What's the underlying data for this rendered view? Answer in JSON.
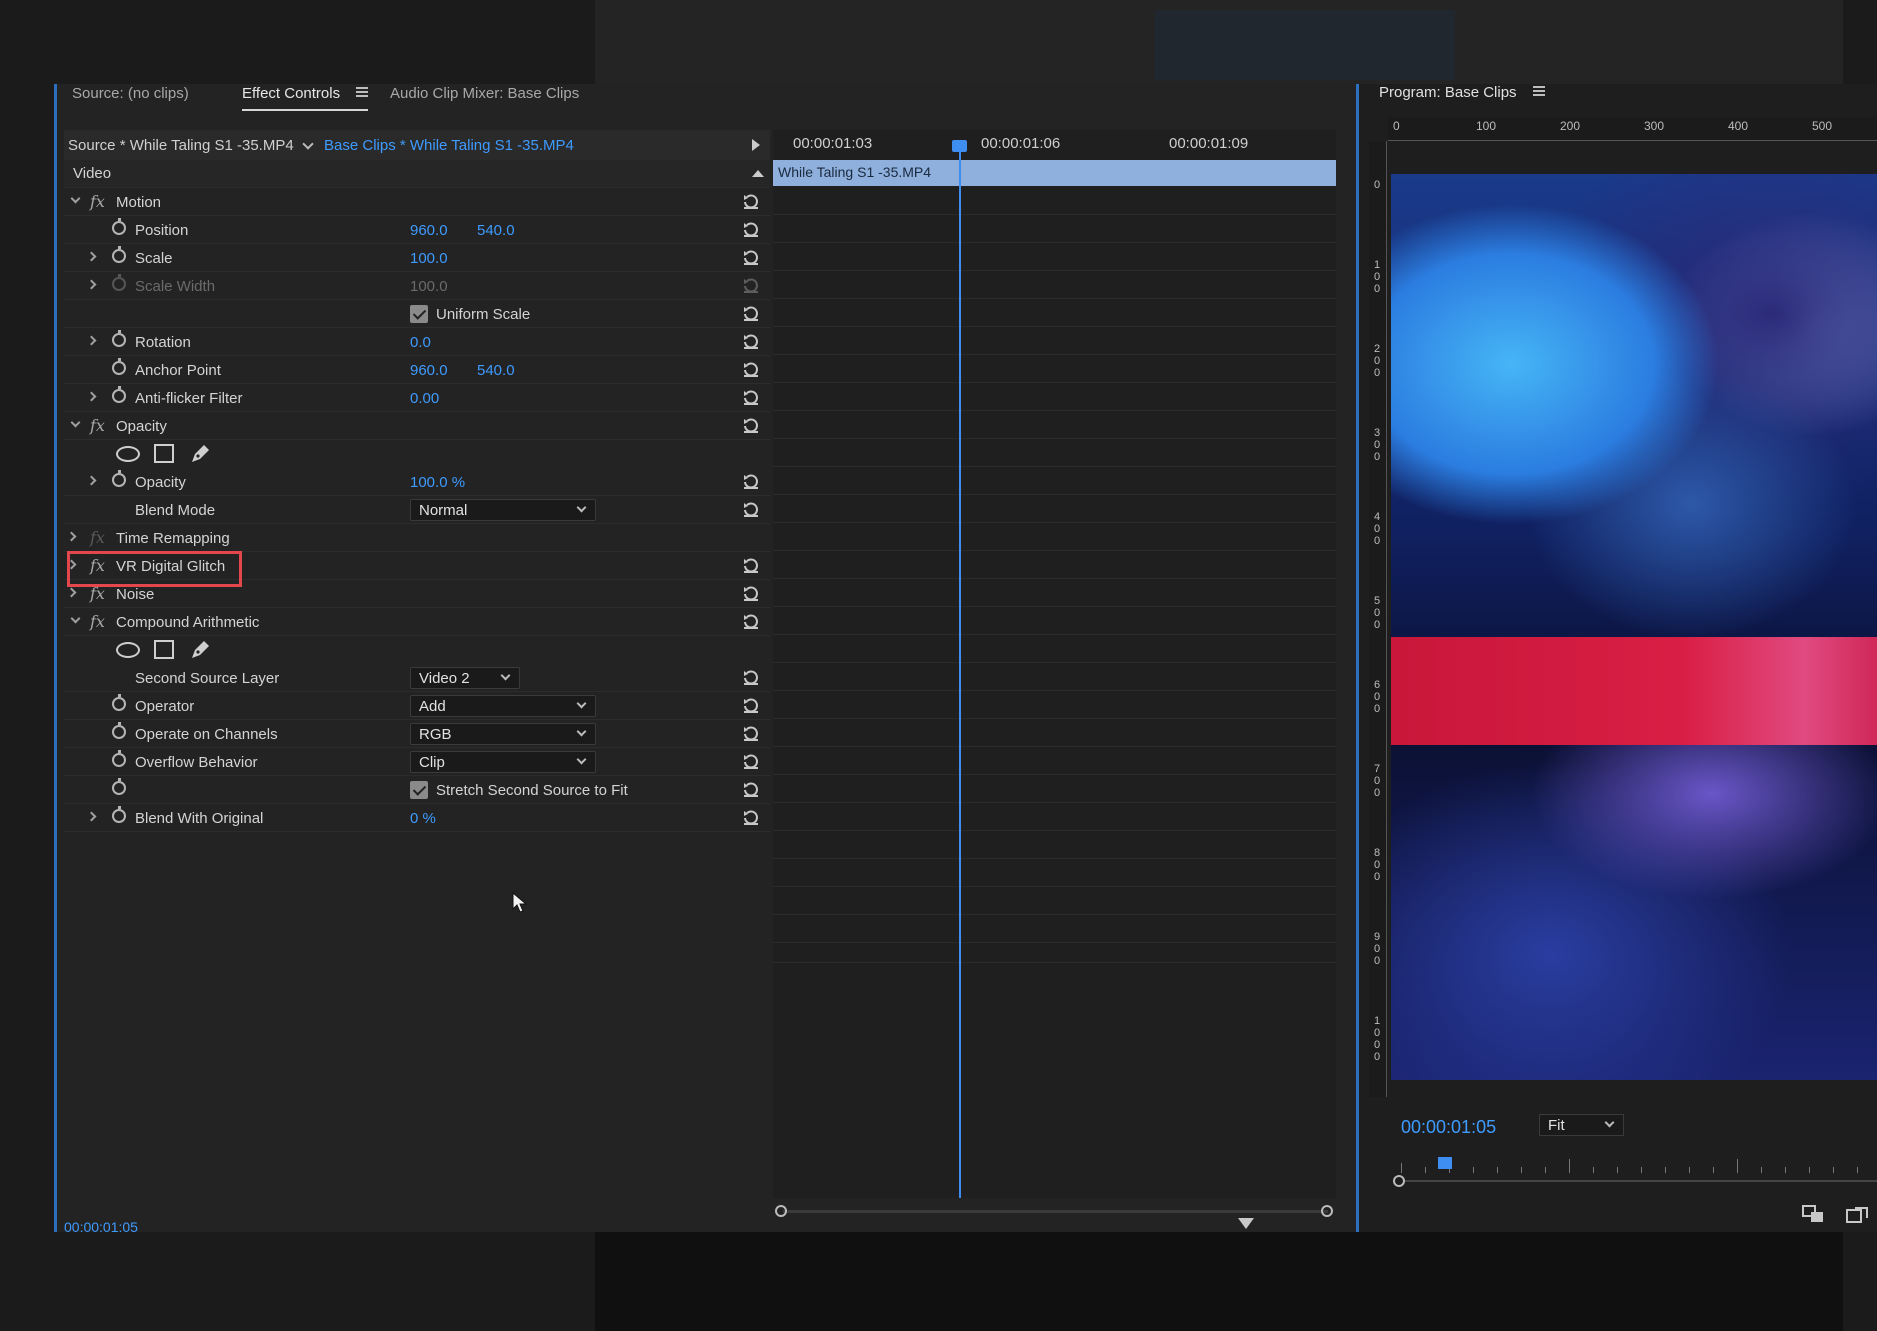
{
  "tabs": {
    "source": "Source: (no clips)",
    "effect_controls": "Effect Controls",
    "audio_mixer": "Audio Clip Mixer: Base Clips"
  },
  "header": {
    "source_clip": "Source * While Taling S1 -35.MP4",
    "sequence_clip": "Base Clips * While Taling S1 -35.MP4"
  },
  "section_video": "Video",
  "rows": {
    "motion": "Motion",
    "position": {
      "label": "Position",
      "x": "960.0",
      "y": "540.0"
    },
    "scale": {
      "label": "Scale",
      "value": "100.0"
    },
    "scale_width": {
      "label": "Scale Width",
      "value": "100.0"
    },
    "uniform_scale": "Uniform Scale",
    "rotation": {
      "label": "Rotation",
      "value": "0.0"
    },
    "anchor": {
      "label": "Anchor Point",
      "x": "960.0",
      "y": "540.0"
    },
    "antiflicker": {
      "label": "Anti-flicker Filter",
      "value": "0.00"
    },
    "opacity_group": "Opacity",
    "opacity": {
      "label": "Opacity",
      "value": "100.0 %"
    },
    "blend_mode": {
      "label": "Blend Mode",
      "value": "Normal"
    },
    "time_remapping": "Time Remapping",
    "vr_glitch": "VR Digital Glitch",
    "noise": "Noise",
    "compound": "Compound Arithmetic",
    "second_source": {
      "label": "Second Source Layer",
      "value": "Video 2"
    },
    "operator": {
      "label": "Operator",
      "value": "Add"
    },
    "channels": {
      "label": "Operate on Channels",
      "value": "RGB"
    },
    "overflow": {
      "label": "Overflow Behavior",
      "value": "Clip"
    },
    "stretch": "Stretch Second Source to Fit",
    "blend_original": {
      "label": "Blend With Original",
      "value": "0 %"
    }
  },
  "timeline": {
    "times": [
      "00:00:01:03",
      "00:00:01:06",
      "00:00:01:09"
    ],
    "clip_name": "While Taling S1 -35.MP4",
    "current_time": "00:00:01:05"
  },
  "program": {
    "title": "Program: Base Clips",
    "ruler_top": [
      "0",
      "100",
      "200",
      "300",
      "400",
      "500"
    ],
    "ruler_left": [
      "0",
      "100",
      "200",
      "300",
      "400",
      "500",
      "600",
      "700",
      "800",
      "900",
      "1000"
    ],
    "timecode": "00:00:01:05",
    "zoom": "Fit"
  },
  "colors": {
    "accent": "#3e9bff",
    "highlight": "#e4474b",
    "clip_bar": "#8fb0dc"
  }
}
